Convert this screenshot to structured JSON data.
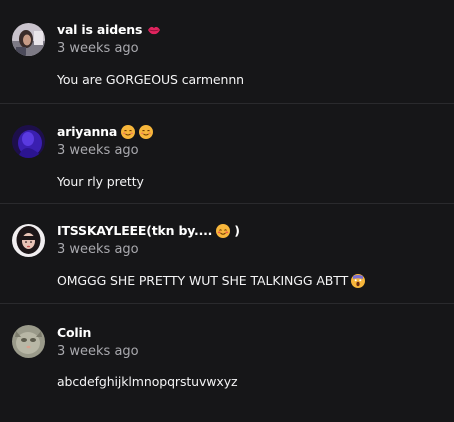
{
  "comments": [
    {
      "username": "val is aidens",
      "username_emoji": "kiss-lips-icon",
      "time": "3 weeks ago",
      "text": "You are GORGEOUS carmennn",
      "text_emoji": ""
    },
    {
      "username": "ariyanna",
      "username_emoji": "smiling-face-icon",
      "time": "3 weeks ago",
      "text": "Your rly pretty",
      "text_emoji": ""
    },
    {
      "username": "ITSSKAYLEEE(tkn by....",
      "username_suffix": ")",
      "username_emoji": "blushing-face-icon",
      "time": "3 weeks ago",
      "text": "OMGGG SHE PRETTY WUT SHE TALKINGG ABTT",
      "text_emoji": "screaming-face-icon"
    },
    {
      "username": "Colin",
      "username_emoji": "",
      "time": "3 weeks ago",
      "text": "abcdefghijklmnopqrstuvwxyz",
      "text_emoji": ""
    }
  ],
  "colors": {
    "background": "#161618",
    "divider": "#2a2a2d",
    "timestamp": "#a9a9ae",
    "emoji_yellow": "#f7b63b",
    "kiss_pink": "#e0245e"
  }
}
